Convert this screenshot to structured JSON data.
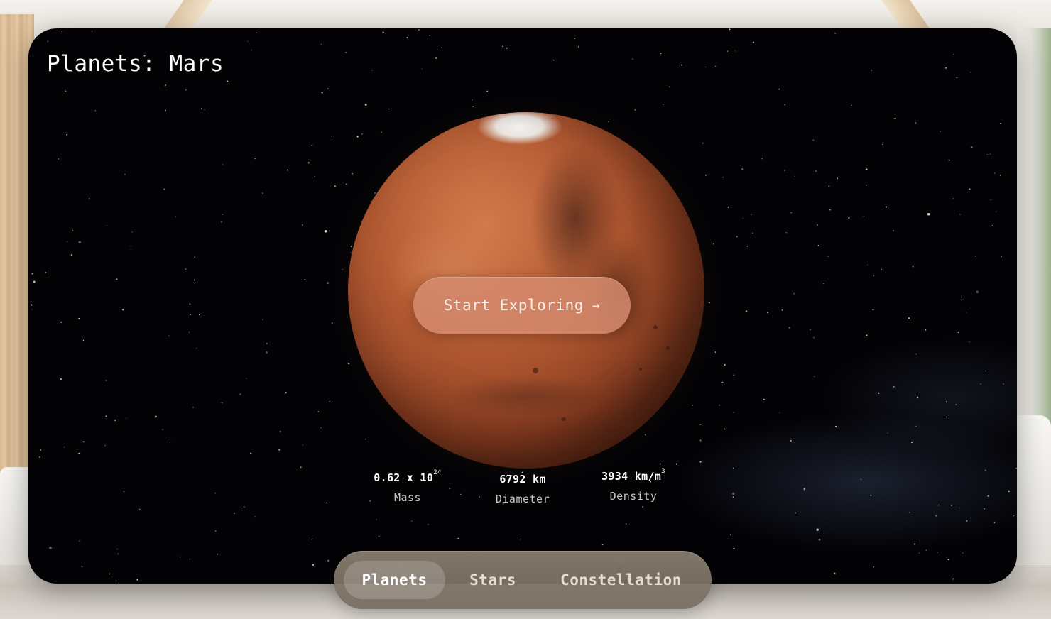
{
  "window": {
    "title": "Planets: Mars"
  },
  "planet": {
    "name": "Mars",
    "icon": "mars-globe"
  },
  "cta": {
    "label": "Start Exploring",
    "arrow": "→"
  },
  "stats": {
    "mass": {
      "base": "0.62 x 10",
      "exponent": "24",
      "label": "Mass"
    },
    "diameter": {
      "value": "6792 km",
      "label": "Diameter"
    },
    "density": {
      "base": "3934 km/m",
      "exponent": "3",
      "label": "Density"
    }
  },
  "tabs": [
    {
      "label": "Planets",
      "active": true
    },
    {
      "label": "Stars",
      "active": false
    },
    {
      "label": "Constellation",
      "active": false
    }
  ],
  "colors": {
    "accent": "#d68c70",
    "space": "#030306",
    "planet": "#b55b33"
  }
}
